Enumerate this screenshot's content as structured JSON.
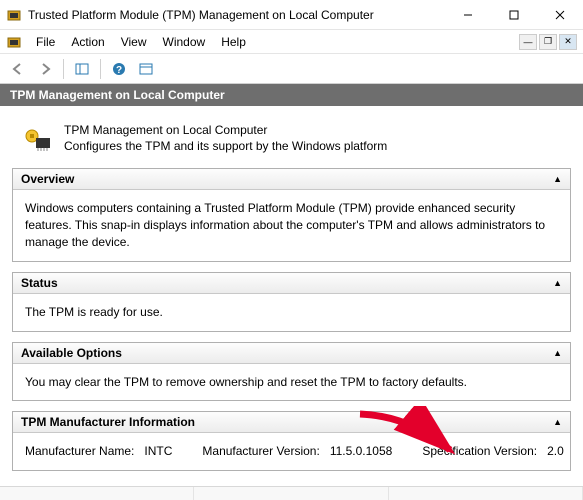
{
  "window": {
    "title": "Trusted Platform Module (TPM) Management on Local Computer"
  },
  "menu": {
    "file": "File",
    "action": "Action",
    "view": "View",
    "window": "Window",
    "help": "Help"
  },
  "band": {
    "title": "TPM Management on Local Computer"
  },
  "intro": {
    "line1": "TPM Management on Local Computer",
    "line2": "Configures the TPM and its support by the Windows platform"
  },
  "panels": {
    "overview": {
      "title": "Overview",
      "body": "Windows computers containing a Trusted Platform Module (TPM) provide enhanced security features. This snap-in displays information about the computer's TPM and allows administrators to manage the device."
    },
    "status": {
      "title": "Status",
      "body": "The TPM is ready for use."
    },
    "options": {
      "title": "Available Options",
      "body": "You may clear the TPM to remove ownership and reset the TPM to factory defaults."
    },
    "mfg": {
      "title": "TPM Manufacturer Information",
      "name_label": "Manufacturer Name:",
      "name_value": "INTC",
      "ver_label": "Manufacturer Version:",
      "ver_value": "11.5.0.1058",
      "spec_label": "Specification Version:",
      "spec_value": "2.0"
    }
  }
}
